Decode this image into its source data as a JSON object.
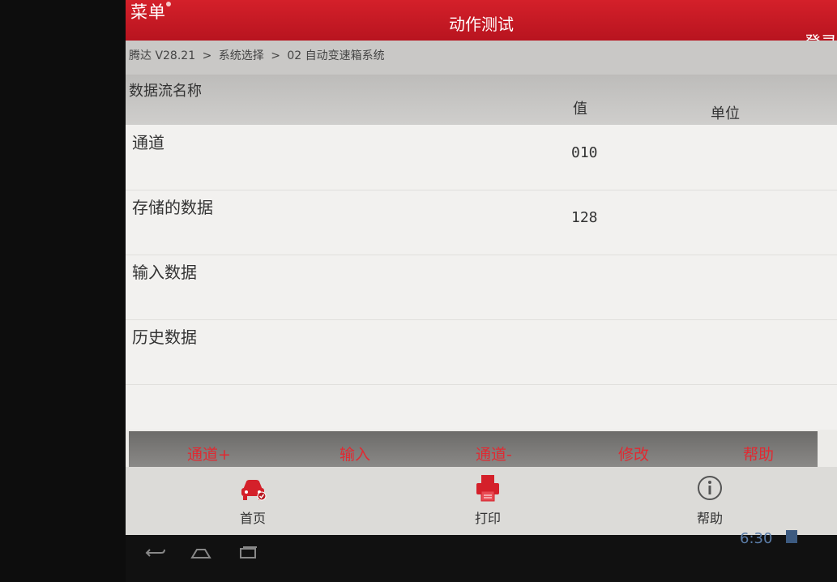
{
  "app": {
    "menu_label": "菜单",
    "title": "动作测试",
    "login_label": "登录"
  },
  "breadcrumb": [
    "腾达 V28.21",
    ">",
    "系统选择",
    ">",
    "02 自动变速箱系统"
  ],
  "table": {
    "headers": {
      "name": "数据流名称",
      "value": "值",
      "unit": "单位"
    },
    "rows": [
      {
        "name": "通道",
        "value": "010",
        "unit": ""
      },
      {
        "name": "存储的数据",
        "value": "128",
        "unit": ""
      },
      {
        "name": "输入数据",
        "value": "",
        "unit": ""
      },
      {
        "name": "历史数据",
        "value": "",
        "unit": ""
      }
    ]
  },
  "actions": [
    "通道+",
    "输入",
    "通道-",
    "修改",
    "帮助"
  ],
  "nav": [
    {
      "label": "首页",
      "icon": "car-icon"
    },
    {
      "label": "打印",
      "icon": "printer-icon"
    },
    {
      "label": "帮助",
      "icon": "info-icon"
    }
  ],
  "system": {
    "clock": "6:30"
  },
  "colors": {
    "accent": "#c8141e",
    "action_text": "#e02a32"
  }
}
